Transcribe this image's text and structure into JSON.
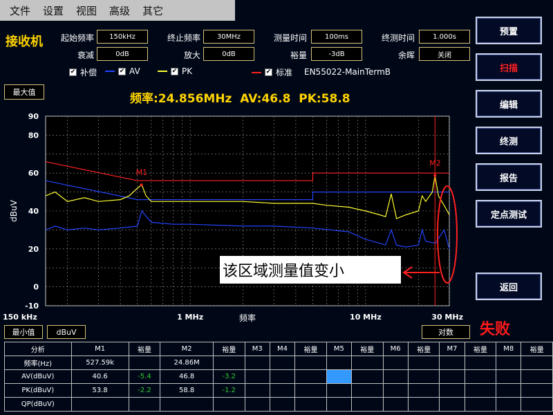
{
  "menu": [
    "文件",
    "设置",
    "视图",
    "高级",
    "其它"
  ],
  "app_title": "接收机",
  "params": {
    "start_freq": {
      "label": "起始频率",
      "value": "150kHz"
    },
    "stop_freq": {
      "label": "终止频率",
      "value": "30MHz"
    },
    "meas_time": {
      "label": "测量时间",
      "value": "100ms"
    },
    "final_time": {
      "label": "终测时间",
      "value": "1.000s"
    },
    "atten": {
      "label": "衰减",
      "value": "0dB"
    },
    "amp": {
      "label": "放大",
      "value": "0dB"
    },
    "margin": {
      "label": "裕量",
      "value": "-3dB"
    },
    "afterglow": {
      "label": "余晖",
      "value": "关闭"
    }
  },
  "legend": {
    "comp": "补偿",
    "av": "AV",
    "pk": "PK",
    "std": "标准",
    "std_name": "EN55022-MainTermB",
    "colors": {
      "av": "#2244ff",
      "pk": "#ffff33",
      "std": "#ff2222"
    }
  },
  "readout": "频率:24.856MHz  AV:46.8  PK:58.8",
  "max_label": "最大值",
  "min_label": "最小值",
  "unit_box": "dBuV",
  "log_box": "对数",
  "fail_label": "失败",
  "annotation": "该区域测量值变小",
  "buttons": [
    "预置",
    "扫描",
    "编辑",
    "终测",
    "报告",
    "定点测试",
    "返回"
  ],
  "chart_data": {
    "type": "line",
    "xlabel": "频率",
    "ylabel": "dBuV",
    "xscale": "log",
    "xlim": [
      0.15,
      30
    ],
    "ylim": [
      -10,
      90
    ],
    "xticks": [
      {
        "v": 0.15,
        "label": "150 kHz"
      },
      {
        "v": 1,
        "label": "1 MHz"
      },
      {
        "v": 10,
        "label": "10 MHz"
      },
      {
        "v": 30,
        "label": "30 MHz"
      }
    ],
    "yticks": [
      -10,
      0,
      20,
      40,
      60,
      80,
      90
    ],
    "markers": [
      {
        "name": "M1",
        "x": 0.5276,
        "y": 53.8
      },
      {
        "name": "M2",
        "x": 24.856,
        "y": 58.8
      }
    ],
    "series": [
      {
        "name": "标准",
        "color": "#ff2222",
        "x": [
          0.15,
          0.5,
          0.5,
          5,
          5,
          30
        ],
        "y": [
          66,
          56,
          56,
          56,
          60,
          60
        ]
      },
      {
        "name": "AV",
        "color": "#2244ff",
        "x": [
          0.15,
          0.5,
          0.5,
          5,
          5,
          30
        ],
        "y": [
          56,
          46,
          46,
          46,
          50,
          50
        ]
      },
      {
        "name": "AV",
        "color": "#2244ff",
        "x": [
          0.15,
          0.17,
          0.2,
          0.25,
          0.3,
          0.4,
          0.5,
          0.53,
          0.6,
          0.8,
          1,
          2,
          3,
          5,
          8,
          10,
          12,
          13,
          14,
          15,
          17,
          20,
          21,
          22,
          25,
          28,
          30
        ],
        "y": [
          30,
          32,
          30,
          31,
          30,
          31,
          32,
          40,
          34,
          33,
          33,
          32,
          32,
          31,
          29,
          25,
          23,
          22,
          30,
          22,
          21,
          22,
          30,
          24,
          23,
          30,
          20
        ]
      },
      {
        "name": "PK",
        "color": "#ffff33",
        "x": [
          0.15,
          0.17,
          0.2,
          0.25,
          0.3,
          0.4,
          0.45,
          0.5,
          0.53,
          0.56,
          0.6,
          0.8,
          1,
          1.5,
          2,
          3,
          4,
          5,
          6,
          8,
          10,
          12,
          13,
          14,
          15,
          17,
          20,
          21,
          22,
          24,
          24.856,
          26,
          28,
          30
        ],
        "y": [
          48,
          50,
          45,
          47,
          45,
          46,
          48,
          52,
          53.8,
          48,
          45,
          45,
          45,
          45,
          45,
          44,
          44,
          44,
          43,
          42,
          40,
          38,
          37,
          49,
          36,
          38,
          40,
          48,
          45,
          50,
          58.8,
          48,
          43,
          38
        ]
      }
    ]
  },
  "table": {
    "headers": [
      "分析",
      "M1",
      "裕量",
      "M2",
      "裕量",
      "M3",
      "M4",
      "裕量",
      "M5",
      "裕量",
      "M6",
      "裕量",
      "M7",
      "裕量",
      "M8",
      "裕量"
    ],
    "rows": [
      [
        "频率(Hz)",
        "527.59k",
        "",
        "24.86M",
        "",
        "",
        "",
        "",
        "",
        "",
        "",
        "",
        "",
        "",
        "",
        ""
      ],
      [
        "AV(dBuV)",
        "40.6",
        "-5.4",
        "46.8",
        "-3.2",
        "",
        "",
        "",
        "",
        "",
        "",
        "",
        "",
        "",
        "",
        ""
      ],
      [
        "PK(dBuV)",
        "53.8",
        "-2.2",
        "58.8",
        "-1.2",
        "",
        "",
        "",
        "",
        "",
        "",
        "",
        "",
        "",
        "",
        ""
      ],
      [
        "QP(dBuV)",
        "",
        "",
        "",
        "",
        "",
        "",
        "",
        "",
        "",
        "",
        "",
        "",
        "",
        "",
        ""
      ]
    ]
  }
}
